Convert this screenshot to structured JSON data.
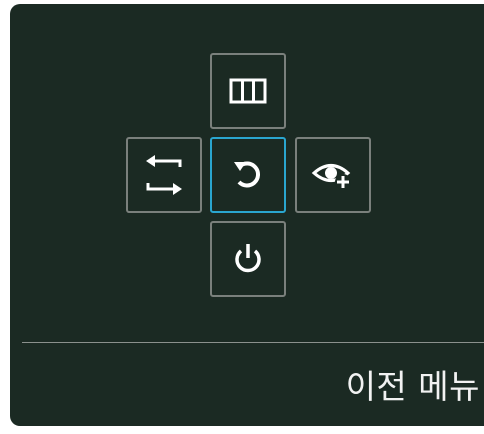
{
  "osd": {
    "keys": [
      {
        "position": "up",
        "icon": "columns-icon",
        "label": ""
      },
      {
        "position": "left",
        "icon": "swap-arrows-icon",
        "label": ""
      },
      {
        "position": "center",
        "icon": "undo-back-icon",
        "label": "",
        "selected": true
      },
      {
        "position": "right",
        "icon": "eye-settings-icon",
        "label": ""
      },
      {
        "position": "down",
        "icon": "power-icon",
        "label": ""
      }
    ],
    "selected_function_label": "이전 메뉴"
  },
  "colors": {
    "panel_background": "#1b2a23",
    "key_border": "#7a807c",
    "selected_border": "#2aa6cf",
    "icon": "#ffffff",
    "text": "#f2f2f2"
  }
}
